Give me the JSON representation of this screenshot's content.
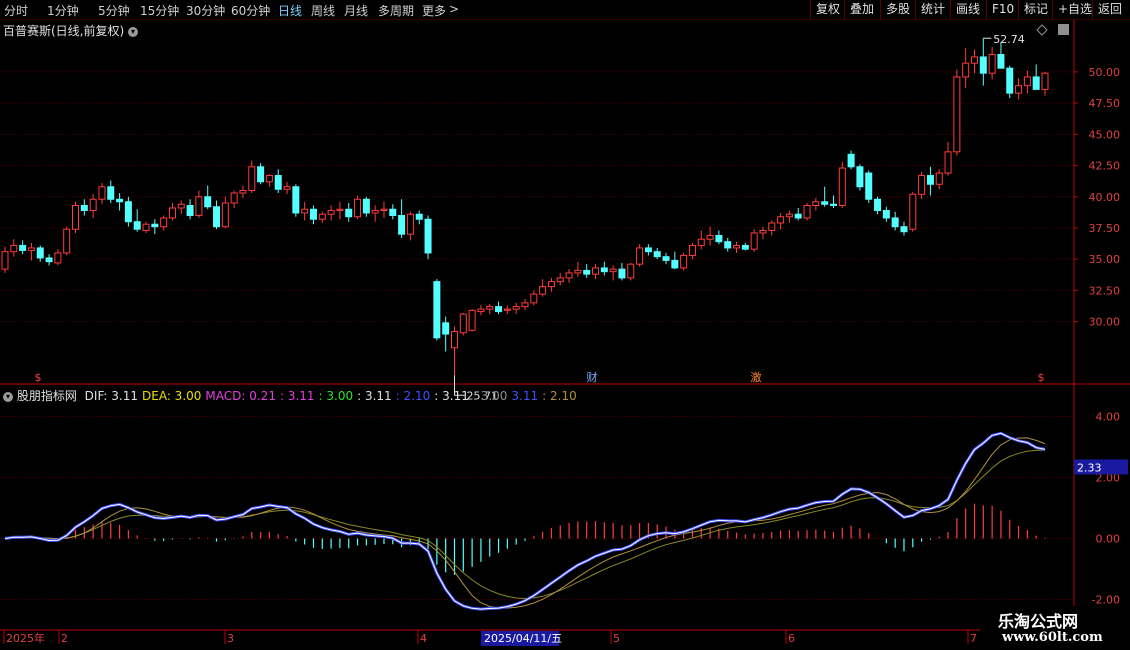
{
  "toolbar": {
    "periods": [
      "分时",
      "1分钟",
      "5分钟",
      "15分钟",
      "30分钟",
      "60分钟",
      "日线",
      "周线",
      "月线",
      "多周期",
      "更多"
    ],
    "active": "日线",
    "right_buttons": [
      "复权",
      "叠加",
      "多股",
      "统计",
      "画线",
      "F10",
      "标记",
      "+自选",
      "返回"
    ]
  },
  "kline_header": {
    "title": "百普赛斯(日线,前复权)",
    "max_label": "52.74",
    "min_label": "25.71",
    "event_markers": [
      "$",
      "财",
      "激",
      "$"
    ]
  },
  "macd_header": {
    "name": "股朋指标网",
    "items": [
      {
        "text": "DIF: 3.11",
        "color": "#e0e0e0"
      },
      {
        "text": "DEA: 3.00",
        "color": "#e8e000"
      },
      {
        "text": "MACD: 0.21",
        "color": "#e040e0"
      },
      {
        "text": ": 3.11",
        "color": "#e040e0"
      },
      {
        "text": ": 3.00",
        "color": "#30e030"
      },
      {
        "text": ": 3.11",
        "color": "#e0e0e0"
      },
      {
        "text": ": 2.10",
        "color": "#4050ff"
      },
      {
        "text": ": 3.11",
        "color": "#e0e0e0"
      },
      {
        "text": ": 3.00",
        "color": "#909090"
      },
      {
        "text": "3.11",
        "color": "#4050ff"
      },
      {
        "text": ": 2.10",
        "color": "#b09040"
      }
    ],
    "current_value": "2.33"
  },
  "price_axis": [
    "50.00",
    "47.50",
    "45.00",
    "42.50",
    "40.00",
    "37.50",
    "35.00",
    "32.50",
    "30.00"
  ],
  "macd_axis": [
    "4.00",
    "2.00",
    "0.00",
    "-2.00"
  ],
  "date_axis": {
    "labels": [
      "2025年",
      "2",
      "3",
      "4",
      "5",
      "6",
      "7"
    ],
    "current_date": "2025/04/11/五"
  },
  "watermark": {
    "title": "乐淘公式网",
    "url": "www.60lt.com"
  },
  "colors": {
    "up": "#ff3c3c",
    "down": "#54ffff",
    "grid": "#5a0000",
    "axis": "#c00000"
  },
  "chart_data": {
    "type": "candlestick",
    "candles_ohlc": [
      [
        34.2,
        36.0,
        33.9,
        35.6
      ],
      [
        35.6,
        36.6,
        35.2,
        36.1
      ],
      [
        36.1,
        36.5,
        35.4,
        35.7
      ],
      [
        35.7,
        36.3,
        34.9,
        35.9
      ],
      [
        35.9,
        36.1,
        34.8,
        35.1
      ],
      [
        35.1,
        35.4,
        34.5,
        34.8
      ],
      [
        34.7,
        35.8,
        34.5,
        35.5
      ],
      [
        35.5,
        37.6,
        35.3,
        37.4
      ],
      [
        37.4,
        39.6,
        37.1,
        39.3
      ],
      [
        39.3,
        39.8,
        38.5,
        38.9
      ],
      [
        38.9,
        40.2,
        38.3,
        39.8
      ],
      [
        39.8,
        41.1,
        39.4,
        40.8
      ],
      [
        40.8,
        41.3,
        39.5,
        39.8
      ],
      [
        39.8,
        40.3,
        38.9,
        39.6
      ],
      [
        39.6,
        40.0,
        37.6,
        38.0
      ],
      [
        38.0,
        39.0,
        37.2,
        37.4
      ],
      [
        37.3,
        38.0,
        37.1,
        37.8
      ],
      [
        37.8,
        38.2,
        37.0,
        37.6
      ],
      [
        37.6,
        38.5,
        37.3,
        38.3
      ],
      [
        38.3,
        39.5,
        38.1,
        39.1
      ],
      [
        39.1,
        39.7,
        38.6,
        39.4
      ],
      [
        39.3,
        39.8,
        38.2,
        38.5
      ],
      [
        38.5,
        40.5,
        38.3,
        40.0
      ],
      [
        40.0,
        40.9,
        39.0,
        39.2
      ],
      [
        39.2,
        39.7,
        37.4,
        37.6
      ],
      [
        37.6,
        40.0,
        37.5,
        39.5
      ],
      [
        39.5,
        40.5,
        39.1,
        40.3
      ],
      [
        40.3,
        40.9,
        39.9,
        40.5
      ],
      [
        40.5,
        42.9,
        40.3,
        42.4
      ],
      [
        42.4,
        42.7,
        41.0,
        41.2
      ],
      [
        41.2,
        41.8,
        40.8,
        41.7
      ],
      [
        41.7,
        42.2,
        40.3,
        40.6
      ],
      [
        40.6,
        41.2,
        40.2,
        40.8
      ],
      [
        40.8,
        41.0,
        38.4,
        38.7
      ],
      [
        38.7,
        39.6,
        38.1,
        39.0
      ],
      [
        39.0,
        39.3,
        37.8,
        38.2
      ],
      [
        38.2,
        38.8,
        37.9,
        38.6
      ],
      [
        38.6,
        39.3,
        38.1,
        38.9
      ],
      [
        38.9,
        39.6,
        38.2,
        39.0
      ],
      [
        39.0,
        39.5,
        38.0,
        38.4
      ],
      [
        38.4,
        40.1,
        38.2,
        39.8
      ],
      [
        39.8,
        40.0,
        38.4,
        38.7
      ],
      [
        38.7,
        39.3,
        38.0,
        38.9
      ],
      [
        38.9,
        39.6,
        38.3,
        39.0
      ],
      [
        39.0,
        39.4,
        38.2,
        38.5
      ],
      [
        38.5,
        39.8,
        36.7,
        37.0
      ],
      [
        37.0,
        38.8,
        36.5,
        38.6
      ],
      [
        38.6,
        38.9,
        37.8,
        38.2
      ],
      [
        38.2,
        38.5,
        35.0,
        35.5
      ],
      [
        33.2,
        33.4,
        28.5,
        28.7
      ],
      [
        29.9,
        30.4,
        27.6,
        29.0
      ],
      [
        27.9,
        29.6,
        25.7,
        29.2
      ],
      [
        29.1,
        30.7,
        28.9,
        30.6
      ],
      [
        29.3,
        31.0,
        29.2,
        30.9
      ],
      [
        30.8,
        31.3,
        30.5,
        31.0
      ],
      [
        31.0,
        31.4,
        30.6,
        31.2
      ],
      [
        31.2,
        31.6,
        30.6,
        30.8
      ],
      [
        30.9,
        31.3,
        30.6,
        31.0
      ],
      [
        31.0,
        31.5,
        30.6,
        31.2
      ],
      [
        31.2,
        31.8,
        30.9,
        31.5
      ],
      [
        31.5,
        32.5,
        31.3,
        32.2
      ],
      [
        32.2,
        33.4,
        32.0,
        32.8
      ],
      [
        32.8,
        33.5,
        32.4,
        33.2
      ],
      [
        33.2,
        33.9,
        32.9,
        33.5
      ],
      [
        33.5,
        34.2,
        33.1,
        33.9
      ],
      [
        33.9,
        34.8,
        33.6,
        34.1
      ],
      [
        34.1,
        34.6,
        33.5,
        33.8
      ],
      [
        33.8,
        34.6,
        33.4,
        34.3
      ],
      [
        34.3,
        34.8,
        33.7,
        34.0
      ],
      [
        34.0,
        34.5,
        33.3,
        34.2
      ],
      [
        34.2,
        34.7,
        33.3,
        33.5
      ],
      [
        33.5,
        34.7,
        33.3,
        34.6
      ],
      [
        34.6,
        36.2,
        34.4,
        35.9
      ],
      [
        35.9,
        36.2,
        35.3,
        35.6
      ],
      [
        35.6,
        35.9,
        35.0,
        35.2
      ],
      [
        35.2,
        35.5,
        34.6,
        34.9
      ],
      [
        34.9,
        35.6,
        34.2,
        34.3
      ],
      [
        34.3,
        35.5,
        34.1,
        35.3
      ],
      [
        35.3,
        36.3,
        35.0,
        36.1
      ],
      [
        36.1,
        37.3,
        35.8,
        36.6
      ],
      [
        36.6,
        37.6,
        36.1,
        36.9
      ],
      [
        36.9,
        37.3,
        36.2,
        36.4
      ],
      [
        36.4,
        36.7,
        35.6,
        35.9
      ],
      [
        35.9,
        36.4,
        35.5,
        36.1
      ],
      [
        36.1,
        36.3,
        35.7,
        35.8
      ],
      [
        35.8,
        37.4,
        35.6,
        37.1
      ],
      [
        37.1,
        37.6,
        36.6,
        37.3
      ],
      [
        37.3,
        38.1,
        36.9,
        37.9
      ],
      [
        37.9,
        38.7,
        37.4,
        38.4
      ],
      [
        38.4,
        38.9,
        37.9,
        38.6
      ],
      [
        38.6,
        39.1,
        38.1,
        38.3
      ],
      [
        38.3,
        39.5,
        38.1,
        39.3
      ],
      [
        39.3,
        39.9,
        38.9,
        39.6
      ],
      [
        39.6,
        40.8,
        39.2,
        39.4
      ],
      [
        39.4,
        40.1,
        39.1,
        39.3
      ],
      [
        39.3,
        42.8,
        39.1,
        42.3
      ],
      [
        43.4,
        43.7,
        42.2,
        42.4
      ],
      [
        42.4,
        42.6,
        40.5,
        40.8
      ],
      [
        41.9,
        42.1,
        39.5,
        39.8
      ],
      [
        39.8,
        40.0,
        38.6,
        38.9
      ],
      [
        38.9,
        39.2,
        38.0,
        38.3
      ],
      [
        38.3,
        38.8,
        37.3,
        37.6
      ],
      [
        37.6,
        38.0,
        36.9,
        37.2
      ],
      [
        37.4,
        40.4,
        37.2,
        40.2
      ],
      [
        40.2,
        42.0,
        39.8,
        41.7
      ],
      [
        41.7,
        42.4,
        40.1,
        41.0
      ],
      [
        41.0,
        42.2,
        40.6,
        41.9
      ],
      [
        41.9,
        44.4,
        41.7,
        43.6
      ],
      [
        43.6,
        50.2,
        43.3,
        49.6
      ],
      [
        49.6,
        51.9,
        48.7,
        50.7
      ],
      [
        50.7,
        51.8,
        49.9,
        51.2
      ],
      [
        51.2,
        52.7,
        48.9,
        49.9
      ],
      [
        49.9,
        52.0,
        49.4,
        51.4
      ],
      [
        51.4,
        52.4,
        50.5,
        50.3
      ],
      [
        50.3,
        50.5,
        47.9,
        48.3
      ],
      [
        48.3,
        49.5,
        47.8,
        48.9
      ],
      [
        48.9,
        50.1,
        48.3,
        49.6
      ],
      [
        49.6,
        50.6,
        49.0,
        48.6
      ],
      [
        48.6,
        50.0,
        48.1,
        49.9
      ]
    ],
    "macd": {
      "dif_range": [
        -2.4,
        3.5
      ],
      "dea_range": [
        -1.2,
        3.1
      ],
      "hist_range": [
        -1.2,
        1.2
      ]
    },
    "price_range": [
      25.0,
      54.0
    ],
    "macd_range": [
      -3.0,
      5.0
    ]
  }
}
